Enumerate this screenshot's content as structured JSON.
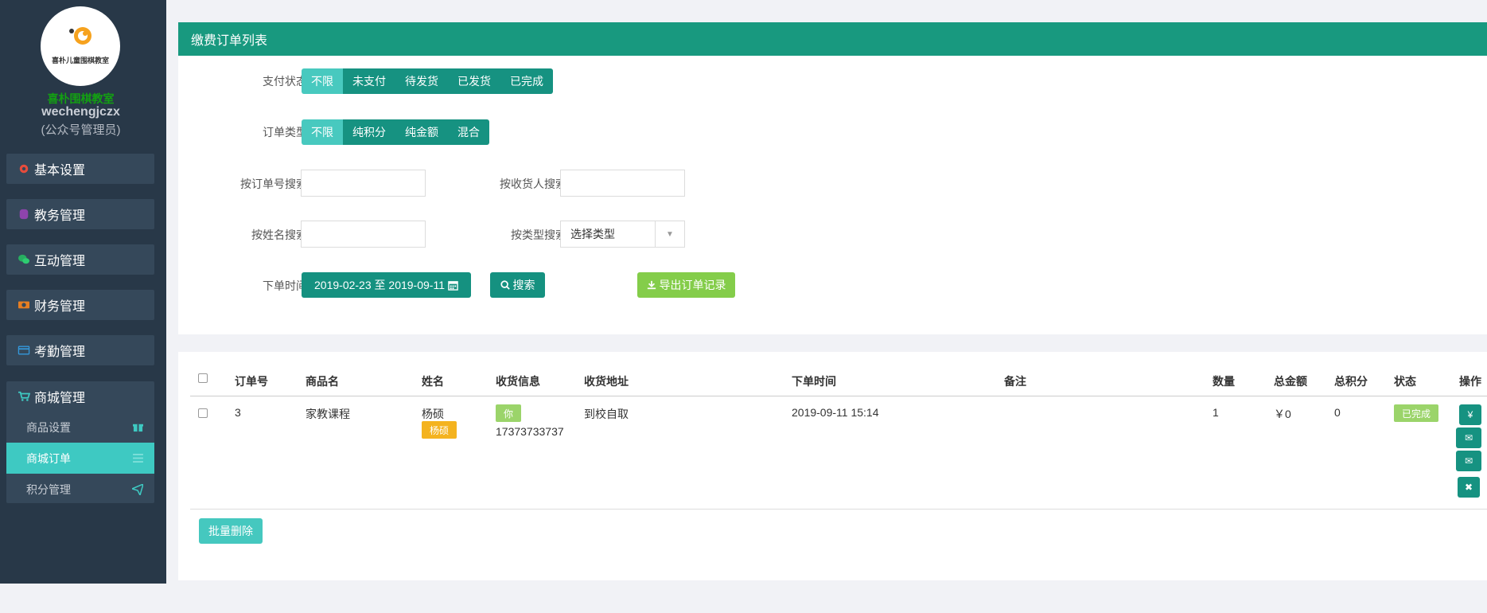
{
  "sidebar": {
    "logo_text": "喜朴儿童围棋教室",
    "school_name": "喜朴围棋教室",
    "username": "wechengjczx",
    "role": "(公众号管理员)",
    "menus": [
      {
        "label": "基本设置",
        "icon": "gear-icon",
        "color": "#e74c3c"
      },
      {
        "label": "教务管理",
        "icon": "database-icon",
        "color": "#8e44ad"
      },
      {
        "label": "互动管理",
        "icon": "wechat-icon",
        "color": "#27ae60"
      },
      {
        "label": "财务管理",
        "icon": "money-icon",
        "color": "#e67e22"
      },
      {
        "label": "考勤管理",
        "icon": "card-icon",
        "color": "#3498db"
      }
    ],
    "shop": {
      "label": "商城管理",
      "icon": "cart-icon",
      "items": [
        {
          "label": "商品设置",
          "icon": "gift-icon"
        },
        {
          "label": "商城订单",
          "icon": "list-icon"
        },
        {
          "label": "积分管理",
          "icon": "send-icon"
        }
      ]
    }
  },
  "filters": {
    "title": "缴费订单列表",
    "pay_status_label": "支付状态",
    "pay_status_options": [
      "不限",
      "未支付",
      "待发货",
      "已发货",
      "已完成"
    ],
    "order_type_label": "订单类型",
    "order_type_options": [
      "不限",
      "纯积分",
      "纯金额",
      "混合"
    ],
    "order_no_label": "按订单号搜索",
    "receiver_label": "按收货人搜索",
    "name_label": "按姓名搜索",
    "type_search_label": "按类型搜索",
    "type_select_value": "选择类型",
    "time_label": "下单时间",
    "date_range": "2019-02-23 至 2019-09-11",
    "search_label": "搜索",
    "export_label": "导出订单记录"
  },
  "table": {
    "headers": [
      "订单号",
      "商品名",
      "姓名",
      "收货信息",
      "收货地址",
      "下单时间",
      "备注",
      "数量",
      "总金额",
      "总积分",
      "状态",
      "操作"
    ],
    "rows": [
      {
        "order_no": "3",
        "product": "家教课程",
        "name": "杨硕",
        "name_tag": "杨硕",
        "receiver_tag": "你",
        "phone": "17373733737",
        "address": "到校自取",
        "time": "2019-09-11 15:14",
        "note": "",
        "qty": "1",
        "amount": "￥0",
        "points": "0",
        "status": "已完成"
      }
    ],
    "ops": [
      "¥",
      "✉",
      "✉",
      "✖"
    ],
    "batch_delete": "批量删除"
  },
  "colors": {
    "primary": "#18997f",
    "accent": "#48c9bf",
    "success": "#84cd4a",
    "warning": "#f4b31f",
    "sidebar": "#283848"
  }
}
